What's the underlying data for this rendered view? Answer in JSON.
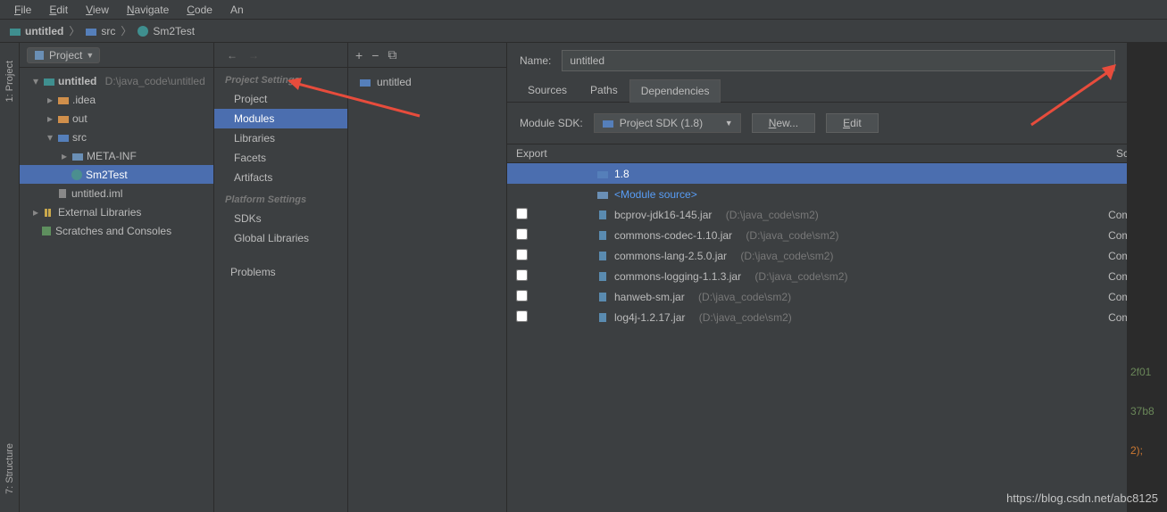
{
  "menu": {
    "file": "File",
    "edit": "Edit",
    "view": "View",
    "navigate": "Navigate",
    "code": "Code",
    "analyze": "An"
  },
  "breadcrumb": {
    "project": "untitled",
    "src": "src",
    "cls": "Sm2Test"
  },
  "leftgutter": {
    "project": "1: Project",
    "structure": "7: Structure"
  },
  "projectPanel": {
    "header": "Project",
    "root": {
      "name": "untitled",
      "path": "D:\\java_code\\untitled"
    },
    "idea": ".idea",
    "out": "out",
    "src": "src",
    "metainf": "META-INF",
    "sm2test": "Sm2Test",
    "iml": "untitled.iml",
    "extlib": "External Libraries",
    "scratch": "Scratches and Consoles"
  },
  "settings": {
    "groupProject": "Project Settings",
    "project": "Project",
    "modules": "Modules",
    "libraries": "Libraries",
    "facets": "Facets",
    "artifacts": "Artifacts",
    "groupPlatform": "Platform Settings",
    "sdks": "SDKs",
    "globalLibs": "Global Libraries",
    "problems": "Problems"
  },
  "modules": {
    "name": "untitled"
  },
  "rightPane": {
    "nameLabel": "Name:",
    "nameValue": "untitled",
    "tabs": {
      "sources": "Sources",
      "paths": "Paths",
      "dependencies": "Dependencies"
    },
    "sdkLabel": "Module SDK:",
    "sdkValue": "Project SDK (1.8)",
    "newBtn": "New...",
    "editBtn": "Edit",
    "headers": {
      "export": "Export",
      "scope": "Scope"
    },
    "rows": {
      "sdk": "1.8",
      "modsrc": "<Module source>",
      "jar1": {
        "name": "bcprov-jdk16-145.jar",
        "path": "(D:\\java_code\\sm2)",
        "scope": "Compile"
      },
      "jar2": {
        "name": "commons-codec-1.10.jar",
        "path": "(D:\\java_code\\sm2)",
        "scope": "Compile"
      },
      "jar3": {
        "name": "commons-lang-2.5.0.jar",
        "path": "(D:\\java_code\\sm2)",
        "scope": "Compile"
      },
      "jar4": {
        "name": "commons-logging-1.1.3.jar",
        "path": "(D:\\java_code\\sm2)",
        "scope": "Compile"
      },
      "jar5": {
        "name": "hanweb-sm.jar",
        "path": "(D:\\java_code\\sm2)",
        "scope": "Compile"
      },
      "jar6": {
        "name": "log4j-1.2.17.jar",
        "path": "(D:\\java_code\\sm2)",
        "scope": "Compile"
      }
    }
  },
  "codefrag": {
    "l1": "2f01",
    "l2": "37b8",
    "l3": "2);"
  },
  "watermark": "https://blog.csdn.net/abc8125"
}
